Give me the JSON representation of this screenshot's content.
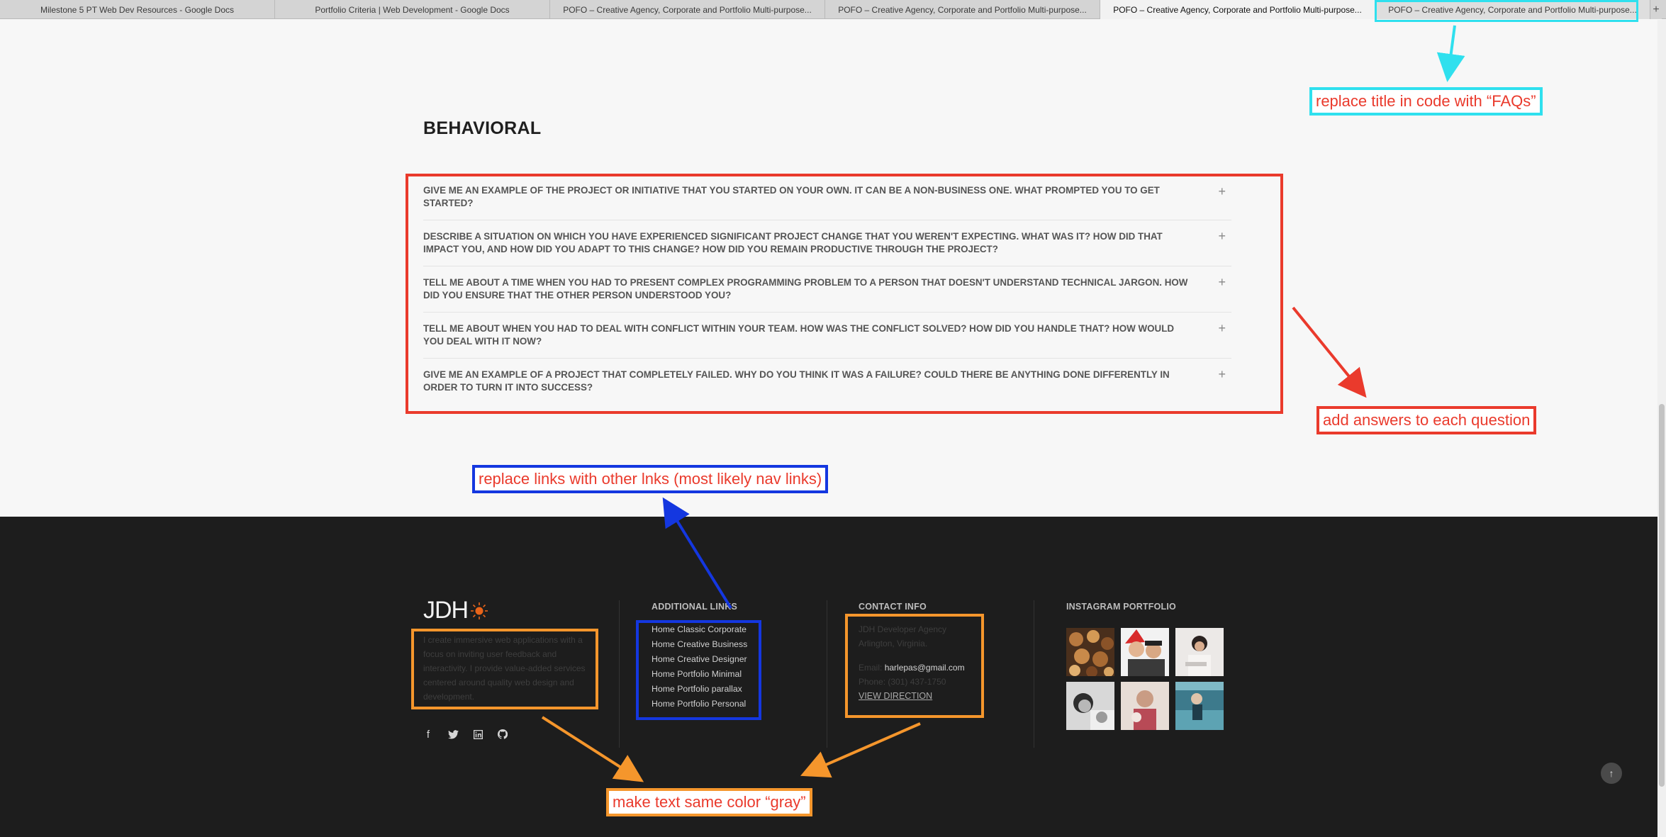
{
  "browser": {
    "tabs": [
      {
        "title": "Milestone 5 PT Web Dev Resources - Google Docs",
        "active": false
      },
      {
        "title": "Portfolio Criteria | Web Development - Google Docs",
        "active": false
      },
      {
        "title": "POFO – Creative Agency, Corporate and Portfolio Multi-purpose...",
        "active": false
      },
      {
        "title": "POFO – Creative Agency, Corporate and Portfolio Multi-purpose...",
        "active": false
      },
      {
        "title": "POFO – Creative Agency, Corporate and Portfolio Multi-purpose...",
        "active": true
      },
      {
        "title": "POFO – Creative Agency, Corporate and Portfolio Multi-purpose...",
        "active": false
      }
    ],
    "new_tab_label": "+"
  },
  "faq": {
    "title": "BEHAVIORAL",
    "items": [
      "GIVE ME AN EXAMPLE OF THE PROJECT OR INITIATIVE THAT YOU STARTED ON YOUR OWN. IT CAN BE A NON-BUSINESS ONE. WHAT PROMPTED YOU TO GET STARTED?",
      "DESCRIBE A SITUATION ON WHICH YOU HAVE EXPERIENCED SIGNIFICANT PROJECT CHANGE THAT YOU WEREN'T EXPECTING. WHAT WAS IT? HOW DID THAT IMPACT YOU, AND HOW DID YOU ADAPT TO THIS CHANGE? HOW DID YOU REMAIN PRODUCTIVE THROUGH THE PROJECT?",
      "TELL ME ABOUT A TIME WHEN YOU HAD TO PRESENT COMPLEX PROGRAMMING PROBLEM TO A PERSON THAT DOESN'T UNDERSTAND TECHNICAL JARGON. HOW DID YOU ENSURE THAT THE OTHER PERSON UNDERSTOOD YOU?",
      "TELL ME ABOUT WHEN YOU HAD TO DEAL WITH CONFLICT WITHIN YOUR TEAM. HOW WAS THE CONFLICT SOLVED? HOW DID YOU HANDLE THAT? HOW WOULD YOU DEAL WITH IT NOW?",
      "GIVE ME AN EXAMPLE OF A PROJECT THAT COMPLETELY FAILED. WHY DO YOU THINK IT WAS A FAILURE? COULD THERE BE ANYTHING DONE DIFFERENTLY IN ORDER TO TURN IT INTO SUCCESS?"
    ],
    "expand_icon": "plus-icon",
    "expand_glyph": "+"
  },
  "footer": {
    "logo_text": "JDH",
    "about": "I create immersive web applications with a focus on inviting user feedback and interactivity. I provide value-added services centered around quality web design and development.",
    "social_icons": [
      "facebook-icon",
      "twitter-icon",
      "linkedin-icon",
      "github-icon"
    ],
    "social_glyphs": [
      "f",
      "𝕥",
      "in",
      "●"
    ],
    "links_title": "ADDITIONAL LINKS",
    "links": [
      "Home Classic Corporate",
      "Home Creative Business",
      "Home Creative Designer",
      "Home Portfolio Minimal",
      "Home Portfolio parallax",
      "Home Portfolio Personal"
    ],
    "contact_title": "CONTACT INFO",
    "contact": {
      "company": "JDH Developer Agency",
      "location": "Arlington, Virginia.",
      "email_label": "Email:",
      "email": "harlepas@gmail.com",
      "phone": "Phone: (301) 437-1750",
      "view_direction": "VIEW DIRECTION"
    },
    "instagram_title": "INSTAGRAM PORTFOLIO",
    "back_to_top_icon": "arrow-up-icon",
    "back_to_top_glyph": "↑"
  },
  "annotations": {
    "tab_note": "replace title in code with “FAQs”",
    "faq_note": "add answers to each question",
    "links_note": "replace links with other lnks (most likely nav links)",
    "color_note": "make text same color “gray”"
  },
  "colors": {
    "annotation_cyan": "#2fe0ee",
    "annotation_red": "#ea3a2c",
    "annotation_blue": "#1437e0",
    "annotation_orange": "#f5962c",
    "footer_bg": "#1d1d1d",
    "page_bg": "#f7f7f7"
  }
}
